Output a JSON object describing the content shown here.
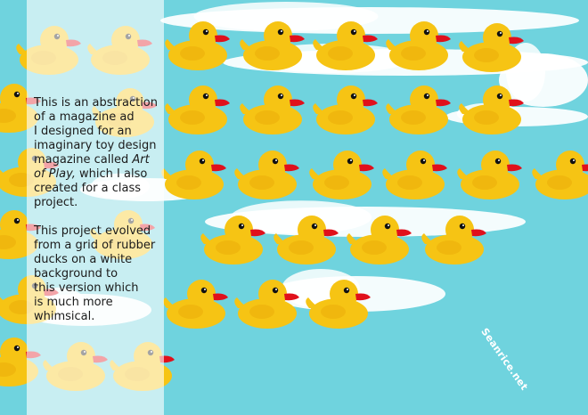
{
  "caption": {
    "paragraph1": {
      "lines": [
        "This is an abstraction",
        "of a magazine ad",
        "I designed for an",
        "imaginary toy design",
        "magazine called "
      ],
      "magazine_part1": "Art",
      "magazine_part2": "of Play,",
      "after_magazine": " which I also",
      "lines_end": [
        "created for a class",
        "project."
      ]
    },
    "paragraph2": {
      "lines": [
        "This project evolved",
        "from a grid of rubber",
        "ducks on a white",
        "background to",
        "this version which",
        "is much more",
        "whimsical."
      ]
    }
  },
  "watermark": "Seanrice.net",
  "colors": {
    "sky": "#6fd3de",
    "cloud": "#ffffff",
    "duck_body": "#f6c414",
    "duck_beak": "#e0101b"
  }
}
